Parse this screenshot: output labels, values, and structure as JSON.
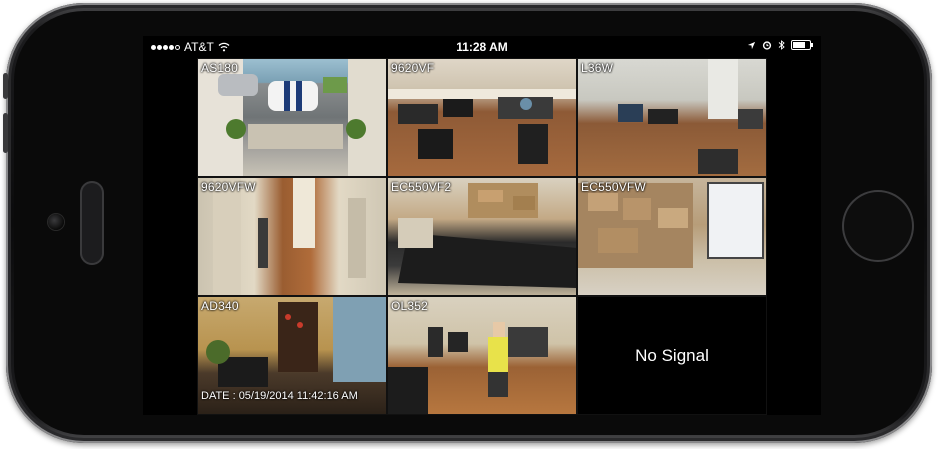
{
  "status_bar": {
    "carrier": "AT&T",
    "time": "11:28 AM"
  },
  "cameras": [
    {
      "label": "AS180"
    },
    {
      "label": "9620VF"
    },
    {
      "label": "L36W"
    },
    {
      "label": "9620VFW"
    },
    {
      "label": "EC550VF2"
    },
    {
      "label": "EC550VFW"
    },
    {
      "label": "AD340"
    },
    {
      "label": "OL352"
    }
  ],
  "no_signal_text": "No Signal",
  "date_stamp": "DATE : 05/19/2014  11:42:16 AM",
  "colors": {
    "phone_body": "#0b0b0c",
    "screen_bg": "#000000",
    "text": "#ffffff"
  }
}
